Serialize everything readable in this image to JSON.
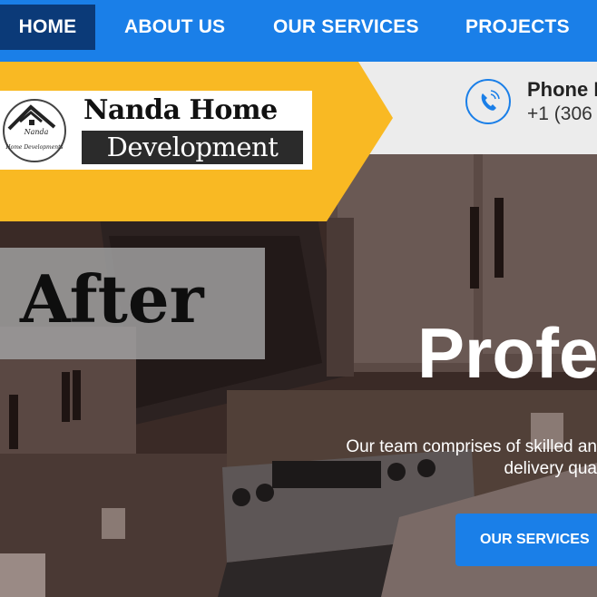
{
  "nav": {
    "items": [
      {
        "label": "HOME",
        "active": true
      },
      {
        "label": "ABOUT US",
        "active": false
      },
      {
        "label": "OUR SERVICES",
        "active": false
      },
      {
        "label": "PROJECTS",
        "active": false
      }
    ]
  },
  "header": {
    "logo": {
      "line1": "Nanda Home",
      "line2": "Development",
      "mark_text_top": "Nanda",
      "mark_text_bottom": "Home Developments",
      "icon": "house-roof-logo-icon"
    },
    "phone": {
      "icon": "phone-icon",
      "label": "Phone N",
      "number": "+1 (306"
    }
  },
  "hero": {
    "badge": "After",
    "title": "Profe",
    "text_line1": "Our team comprises of skilled an",
    "text_line2": "delivery qua",
    "button_label": "OUR SERVICES"
  },
  "colors": {
    "nav_blue": "#1a7fe8",
    "nav_active": "#0b3a78",
    "accent_yellow": "#f9b923",
    "header_gray": "#ececec"
  }
}
